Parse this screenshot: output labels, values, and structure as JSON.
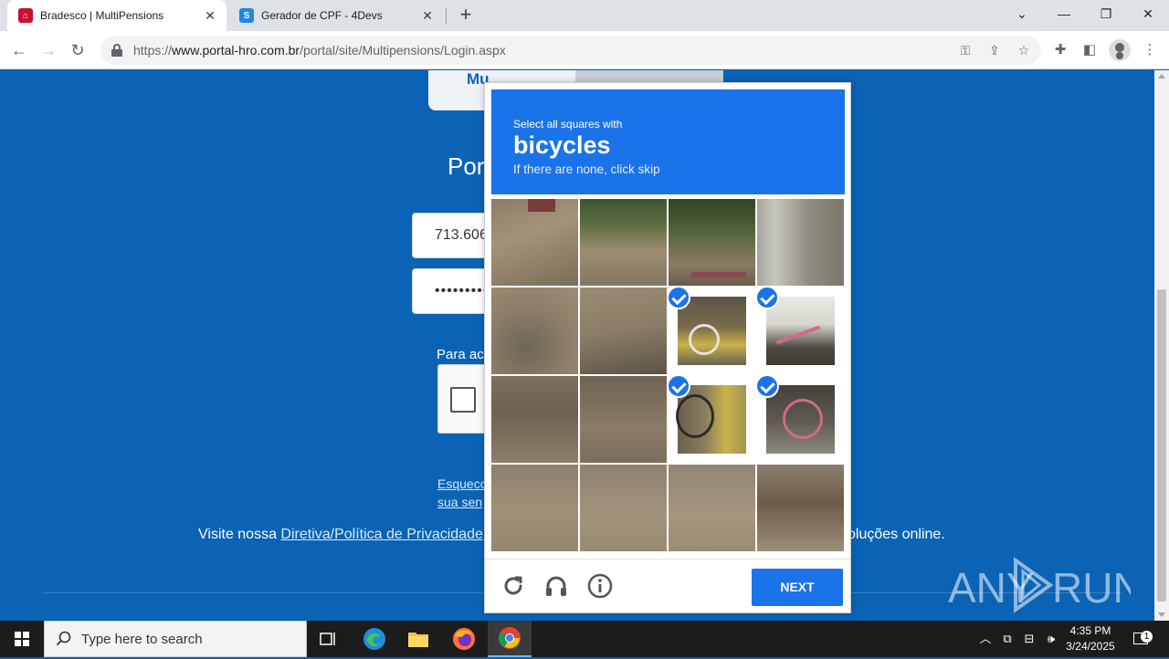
{
  "browser": {
    "tabs": [
      {
        "title": "Bradesco | MultiPensions",
        "active": true,
        "favicon": "bradesco-favicon"
      },
      {
        "title": "Gerador de CPF - 4Devs",
        "active": false,
        "favicon": "4devs-favicon"
      }
    ],
    "url_scheme": "https://",
    "url_host": "www.portal-hro.com.br",
    "url_path": "/portal/site/Multipensions/Login.aspx"
  },
  "page": {
    "tab_left_label": "Mu",
    "heading": "Por",
    "cpf_value": "713.606",
    "password_value": "•••••••••",
    "access_label": "Para ace",
    "forgot_line1": "Esqueco",
    "forgot_line2": "sua sen",
    "privacy_prefix": "Visite nossa ",
    "privacy_link": "Diretiva/Política de Privacidade",
    "privacy_tail": "oluções online."
  },
  "captcha": {
    "instruction": "Select all squares with",
    "target": "bicycles",
    "hint": "If there are none, click skip",
    "next_label": "NEXT",
    "selected_tiles": [
      6,
      7,
      10,
      11
    ],
    "accent_color": "#1a73e8"
  },
  "watermark": {
    "text": "ANY RUN"
  },
  "taskbar": {
    "search_placeholder": "Type here to search",
    "time": "4:35 PM",
    "date": "3/24/2025",
    "notification_count": "1"
  }
}
